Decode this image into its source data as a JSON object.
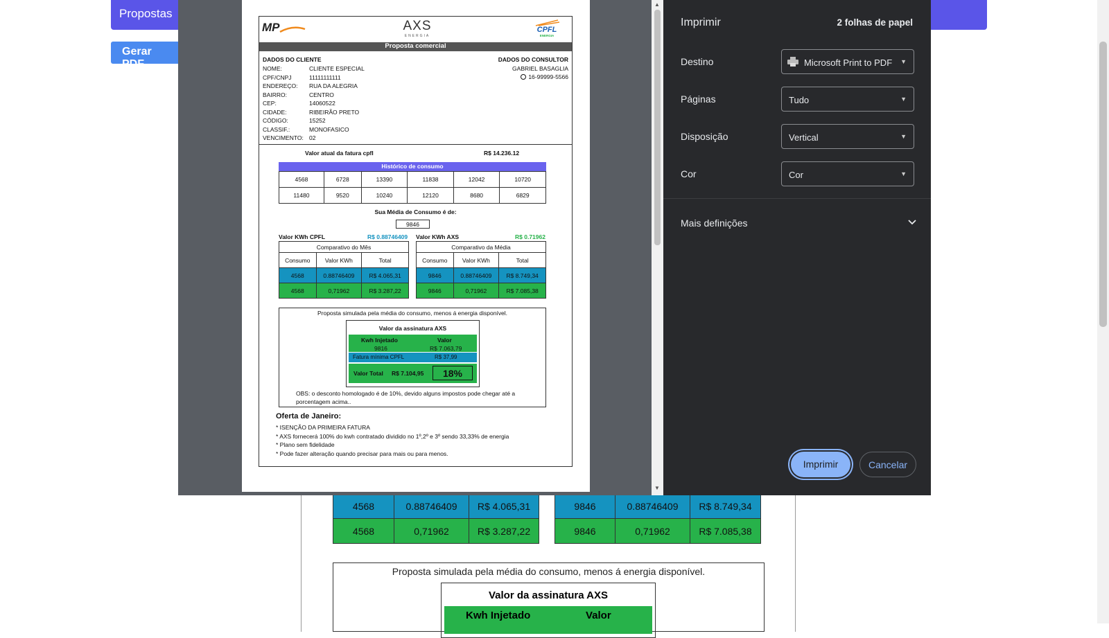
{
  "background": {
    "propostas_label": "Propostas",
    "gerar_pdf_label": "Gerar PDF",
    "table_left": [
      [
        "4568",
        "0.88746409",
        "R$ 4.065,31"
      ],
      [
        "4568",
        "0,71962",
        "R$ 3.287,22"
      ]
    ],
    "table_right": [
      [
        "9846",
        "0.88746409",
        "R$ 8.749,34"
      ],
      [
        "9846",
        "0,71962",
        "R$ 7.085,38"
      ]
    ],
    "proposta_note": "Proposta simulada pela média do consumo, menos á energia disponível.",
    "assinatura_title": "Valor da assinatura AXS",
    "kwh_injetado": "Kwh Injetado",
    "valor": "Valor"
  },
  "print_dialog": {
    "title": "Imprimir",
    "sheets": "2 folhas de papel",
    "destino_label": "Destino",
    "destino_value": "Microsoft Print to PDF",
    "paginas_label": "Páginas",
    "paginas_value": "Tudo",
    "disposicao_label": "Disposição",
    "disposicao_value": "Vertical",
    "cor_label": "Cor",
    "cor_value": "Cor",
    "more_settings": "Mais definições",
    "print_button": "Imprimir",
    "cancel_button": "Cancelar"
  },
  "document": {
    "logo_mp": "MP",
    "logo_axs": "AXS",
    "logo_axs_sub": "ENERGIA",
    "logo_cpfl": "CPFL",
    "logo_cpfl_sub": "ENERGIA",
    "header_bar": "Proposta comercial",
    "client_title": "DADOS DO CLIENTE",
    "client_fields": [
      {
        "label": "NOME:",
        "value": "CLIENTE ESPECIAL"
      },
      {
        "label": "CPF/CNPJ",
        "value": "11111111111"
      },
      {
        "label": "ENDEREÇO:",
        "value": "RUA DA ALEGRIA"
      },
      {
        "label": "BAIRRO:",
        "value": "CENTRO"
      },
      {
        "label": "CEP:",
        "value": "14060522"
      },
      {
        "label": "CIDADE:",
        "value": "RIBEIRÃO PRETO"
      },
      {
        "label": "CÓDIGO:",
        "value": "15252"
      },
      {
        "label": "CLASSIF.:",
        "value": "MONOFASICO"
      },
      {
        "label": "VENCIMENTO:",
        "value": "02"
      }
    ],
    "consultant_title": "DADOS DO CONSULTOR",
    "consultant_name": "GABRIEL BASAGLIA",
    "consultant_phone": "16-99999-5566",
    "fatura_label": "Valor atual da fatura cpfl",
    "fatura_value": "R$ 14.236.12",
    "historico_title": "Histórico de consumo",
    "historico": [
      [
        "4568",
        "6728",
        "13390",
        "11838",
        "12042",
        "10720"
      ],
      [
        "11480",
        "9520",
        "10240",
        "12120",
        "8680",
        "6829"
      ]
    ],
    "media_label": "Sua Média de Consumo é de:",
    "media_value": "9846",
    "kwh_cpfl_label": "Valor KWh CPFL",
    "kwh_cpfl_value": "R$ 0.88746409",
    "kwh_axs_label": "Valor KWh AXS",
    "kwh_axs_value": "R$ 0.71962",
    "comp_mes_title": "Comparativo do Mês",
    "comp_media_title": "Comparativo da Média",
    "comp_headers": [
      "Consumo",
      "Valor KWh",
      "Total"
    ],
    "comp_mes": [
      [
        "4568",
        "0.88746409",
        "R$ 4.065,31"
      ],
      [
        "4568",
        "0,71962",
        "R$ 3.287,22"
      ]
    ],
    "comp_media": [
      [
        "9846",
        "0.88746409",
        "R$ 8.749,34"
      ],
      [
        "9846",
        "0,71962",
        "R$ 7.085,38"
      ]
    ],
    "proposta_note": "Proposta simulada pela média do consumo, menos á energia disponível.",
    "assinatura_title": "Valor da assinatura AXS",
    "kwh_injetado_label": "Kwh Injetado",
    "valor_label": "Valor",
    "kwh_injetado_value": "9816",
    "valor_value": "R$ 7.063,79",
    "fatura_minima_label": "Fatura mínima CPFL",
    "fatura_minima_value": "R$ 37,99",
    "valor_total_label": "Valor Total",
    "valor_total_value": "R$ 7.104,95",
    "desconto": "18%",
    "obs": "OBS: o desconto homologado é de 10%, devido alguns impostos pode chegar até a porcentagem acima..",
    "oferta_title": "Oferta de Janeiro:",
    "oferta_items": [
      "* ISENÇÃO DA PRIMEIRA FATURA",
      "* AXS fornecerá 100% do kwh contratado dividido no 1º,2º e 3º sendo 33,33% de energia",
      "* Plano sem fidelidade",
      "* Pode fazer alteração quando precisar para mais ou para menos."
    ]
  },
  "colors": {
    "blue": "#1593c0",
    "green": "#27b24a",
    "purple": "#6a63ee",
    "accent": "#8ab4f8"
  }
}
